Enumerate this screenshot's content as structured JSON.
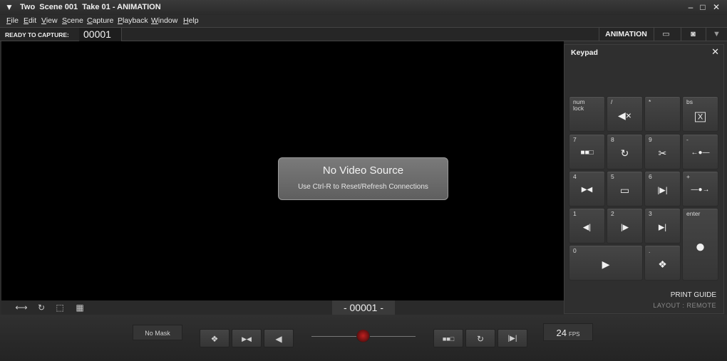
{
  "window": {
    "title": "Two  Scene 001  Take 01 - ANIMATION",
    "minimize_icon": "–",
    "maximize_icon": "□",
    "close_icon": "✕"
  },
  "menu": [
    "File",
    "Edit",
    "View",
    "Scene",
    "Capture",
    "Playback",
    "Window",
    "Help"
  ],
  "status": {
    "ready_label": "READY TO CAPTURE:",
    "frame_number": "00001",
    "mode": "ANIMATION"
  },
  "viewport": {
    "message_title": "No Video Source",
    "message_sub": "Use Ctrl-R to Reset/Refresh Connections"
  },
  "view_toolbar": {
    "counter": "- 00001 -",
    "icons": [
      "resize-icon",
      "refresh-icon",
      "frame-guide-icon",
      "grid-icon"
    ]
  },
  "keypad": {
    "title": "Keypad",
    "print_guide": "PRINT GUIDE",
    "layout": "LAYOUT : REMOTE",
    "keys": [
      {
        "label": "num\nlock",
        "glyph": ""
      },
      {
        "label": "/",
        "glyph": "🔇"
      },
      {
        "label": "*",
        "glyph": ""
      },
      {
        "label": "bs",
        "glyph": "X"
      },
      {
        "label": "7",
        "glyph": "■■□"
      },
      {
        "label": "8",
        "glyph": "↻"
      },
      {
        "label": "9",
        "glyph": "✂"
      },
      {
        "label": "-",
        "glyph": "←●—"
      },
      {
        "label": "4",
        "glyph": "▶◀"
      },
      {
        "label": "5",
        "glyph": "▭"
      },
      {
        "label": "6",
        "glyph": "|▶|"
      },
      {
        "label": "+",
        "glyph": "—●→"
      },
      {
        "label": "1",
        "glyph": "◀|"
      },
      {
        "label": "2",
        "glyph": "|▶"
      },
      {
        "label": "3",
        "glyph": "▶|"
      },
      {
        "label": "enter",
        "glyph": "●"
      },
      {
        "label": "0",
        "glyph": "▶"
      },
      {
        "label": ".",
        "glyph": "❖"
      }
    ]
  },
  "bottom": {
    "mask": "No Mask",
    "fps_value": "24",
    "fps_unit": "FPS",
    "glyphs": {
      "onion": "❖",
      "bowtie": "▶◀",
      "step_back": "◀",
      "frames": "■■□",
      "loop": "↻",
      "step_end": "|▶|"
    }
  }
}
